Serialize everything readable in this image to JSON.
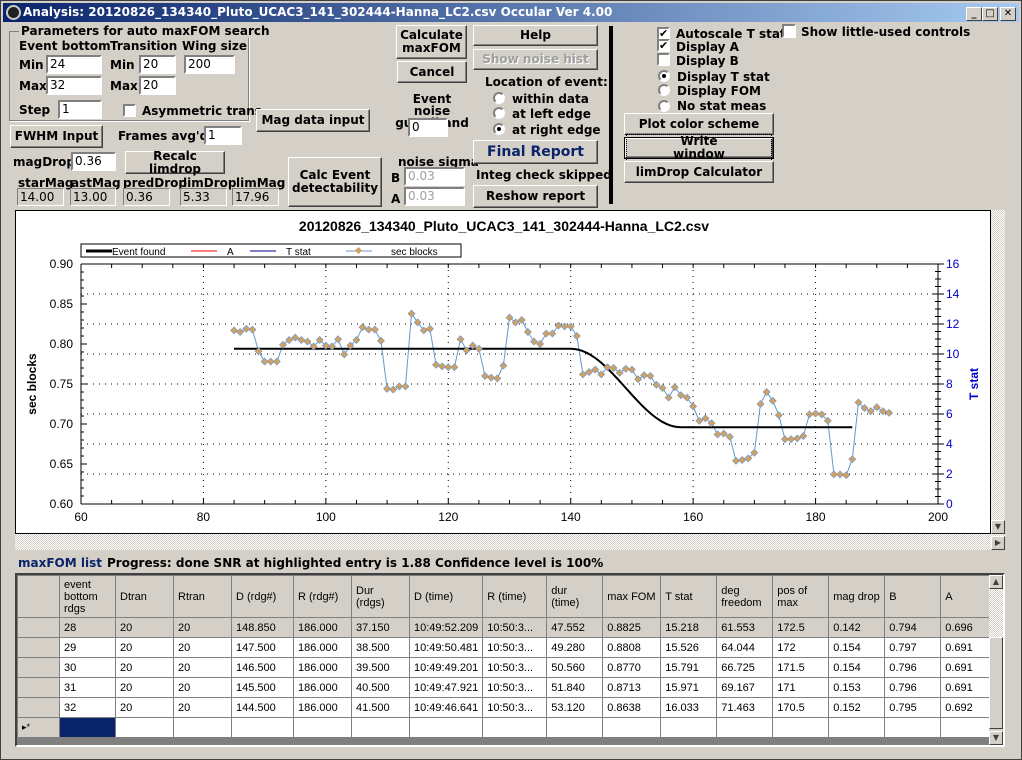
{
  "window": {
    "title": "Analysis: 20120826_134340_Pluto_UCAC3_141_302444-Hanna_LC2.csv  Occular Ver 4.00",
    "controls": {
      "minimize": "_",
      "maximize": "□",
      "close": "✕"
    }
  },
  "params": {
    "group_title": "Parameters for auto maxFOM search",
    "event_bottom_label": "Event bottom",
    "transition_label": "Transition",
    "wing_label": "Wing size",
    "min_label": "Min",
    "max_label": "Max",
    "step_label": "Step",
    "eb_min": "24",
    "eb_max": "32",
    "step": "1",
    "tr_min": "20",
    "tr_max": "20",
    "wing": "200",
    "asym_label": "Asymmetric trans",
    "asym_checked": false
  },
  "buttons": {
    "calc_maxfom": "Calculate maxFOM",
    "cancel": "Cancel",
    "help": "Help",
    "show_noise_hist": "Show noise hist",
    "mag_data_input": "Mag data input",
    "fwhm_input": "FWHM Input",
    "recalc_limdrop": "Recalc limdrop",
    "calc_detect": "Calc Event detectability",
    "final_report": "Final Report",
    "reshow_report": "Reshow report",
    "plot_color": "Plot color scheme",
    "write_window": "Write window",
    "limdrop_calc": "limDrop Calculator"
  },
  "frames": {
    "label": "Frames avg'd:",
    "value": "1"
  },
  "mag": {
    "magdrop_label": "magDrop:",
    "magdrop": "0.36",
    "labels": [
      "starMag",
      "astMag",
      "predDrop",
      "limDrop",
      "limMag"
    ],
    "values": [
      "14.00",
      "13.00",
      "0.36",
      "5.33",
      "17.96"
    ]
  },
  "guardband": {
    "label": "Event noise guardband",
    "value": "0"
  },
  "noise": {
    "label": "noise sigma",
    "b_label": "B",
    "a_label": "A",
    "b": "0.03",
    "a": "0.03"
  },
  "location": {
    "label": "Location of event:",
    "options": [
      "within data",
      "at left edge",
      "at right edge"
    ],
    "selected": 2
  },
  "integ": "Integ check skipped",
  "display": {
    "checks": [
      {
        "label": "Autoscale T stat",
        "checked": true
      },
      {
        "label": "Display A",
        "checked": true
      },
      {
        "label": "Display B",
        "checked": false
      }
    ],
    "radios": [
      "Display T stat",
      "Display FOM",
      "No stat meas"
    ],
    "radio_selected": 0,
    "little_used_label": "Show little-used controls",
    "little_used": false
  },
  "chart_data": {
    "type": "line",
    "title": "20120826_134340_Pluto_UCAC3_141_302444-Hanna_LC2.csv",
    "xlabel": "",
    "ylabel": "sec blocks",
    "y2label": "T stat",
    "xlim": [
      60,
      200
    ],
    "ylim": [
      0.6,
      0.9
    ],
    "y2lim": [
      0,
      16
    ],
    "xticks": [
      60,
      80,
      100,
      120,
      140,
      160,
      180,
      200
    ],
    "yticks": [
      0.6,
      0.65,
      0.7,
      0.75,
      0.8,
      0.85,
      0.9
    ],
    "y2ticks": [
      0,
      2,
      4,
      6,
      8,
      10,
      12,
      14,
      16
    ],
    "grid": true,
    "legend": {
      "placement": "top-left",
      "entries": [
        "Event found",
        "A",
        "T stat",
        "sec blocks"
      ]
    },
    "colors": {
      "event": "#000000",
      "a": "#ff0000",
      "tstat": "#000080",
      "sec": "#6699cc",
      "marker": "#d4a060",
      "axis2": "#0000cc"
    },
    "event_found": {
      "baseline": 0.794,
      "bottom": 0.696,
      "start": 85,
      "d_start": 140,
      "d_end": 158,
      "end": 186
    },
    "sec_blocks": {
      "x_start": 85,
      "values": [
        0.817,
        0.815,
        0.819,
        0.818,
        0.791,
        0.778,
        0.778,
        0.778,
        0.799,
        0.805,
        0.808,
        0.805,
        0.803,
        0.797,
        0.805,
        0.798,
        0.797,
        0.806,
        0.787,
        0.798,
        0.805,
        0.821,
        0.818,
        0.818,
        0.804,
        0.744,
        0.743,
        0.747,
        0.747,
        0.838,
        0.827,
        0.817,
        0.819,
        0.774,
        0.772,
        0.771,
        0.771,
        0.806,
        0.792,
        0.798,
        0.794,
        0.76,
        0.758,
        0.757,
        0.773,
        0.833,
        0.827,
        0.83,
        0.815,
        0.803,
        0.8,
        0.813,
        0.813,
        0.823,
        0.822,
        0.822,
        0.81,
        0.762,
        0.765,
        0.768,
        0.762,
        0.771,
        0.77,
        0.764,
        0.769,
        0.768,
        0.756,
        0.761,
        0.76,
        0.749,
        0.745,
        0.733,
        0.746,
        0.736,
        0.733,
        0.722,
        0.704,
        0.707,
        0.701,
        0.687,
        0.688,
        0.684,
        0.654,
        0.655,
        0.657,
        0.664,
        0.725,
        0.74,
        0.729,
        0.711,
        0.681,
        0.681,
        0.682,
        0.685,
        0.712,
        0.713,
        0.712,
        0.704,
        0.637,
        0.637,
        0.636,
        0.656,
        0.727,
        0.72,
        0.716,
        0.721,
        0.716,
        0.714
      ]
    }
  },
  "status": {
    "list_label": "maxFOM list",
    "progress": "Progress: done  SNR at highlighted entry is 1.88   Confidence level is  100%"
  },
  "table": {
    "headers": [
      "event bottom rdgs",
      "Dtran",
      "Rtran",
      "D (rdg#)",
      "R (rdg#)",
      "Dur (rdgs)",
      "D (time)",
      "R (time)",
      "dur (time)",
      "max FOM",
      "T stat",
      "deg freedom",
      "pos of max",
      "mag drop",
      "B",
      "A"
    ],
    "rows": [
      [
        "28",
        "20",
        "20",
        "148.850",
        "186.000",
        "37.150",
        "10:49:52.209",
        "10:50:3...",
        "47.552",
        "0.8825",
        "15.218",
        "61.553",
        "172.5",
        "0.142",
        "0.794",
        "0.696"
      ],
      [
        "29",
        "20",
        "20",
        "147.500",
        "186.000",
        "38.500",
        "10:49:50.481",
        "10:50:3...",
        "49.280",
        "0.8808",
        "15.526",
        "64.044",
        "172",
        "0.154",
        "0.797",
        "0.691"
      ],
      [
        "30",
        "20",
        "20",
        "146.500",
        "186.000",
        "39.500",
        "10:49:49.201",
        "10:50:3...",
        "50.560",
        "0.8770",
        "15.791",
        "66.725",
        "171.5",
        "0.154",
        "0.796",
        "0.691"
      ],
      [
        "31",
        "20",
        "20",
        "145.500",
        "186.000",
        "40.500",
        "10:49:47.921",
        "10:50:3...",
        "51.840",
        "0.8713",
        "15.971",
        "69.167",
        "171",
        "0.153",
        "0.796",
        "0.691"
      ],
      [
        "32",
        "20",
        "20",
        "144.500",
        "186.000",
        "41.500",
        "10:49:46.641",
        "10:50:3...",
        "53.120",
        "0.8638",
        "16.033",
        "71.463",
        "170.5",
        "0.152",
        "0.795",
        "0.692"
      ]
    ],
    "selected_row": 0,
    "new_row_marker": "▸*"
  }
}
